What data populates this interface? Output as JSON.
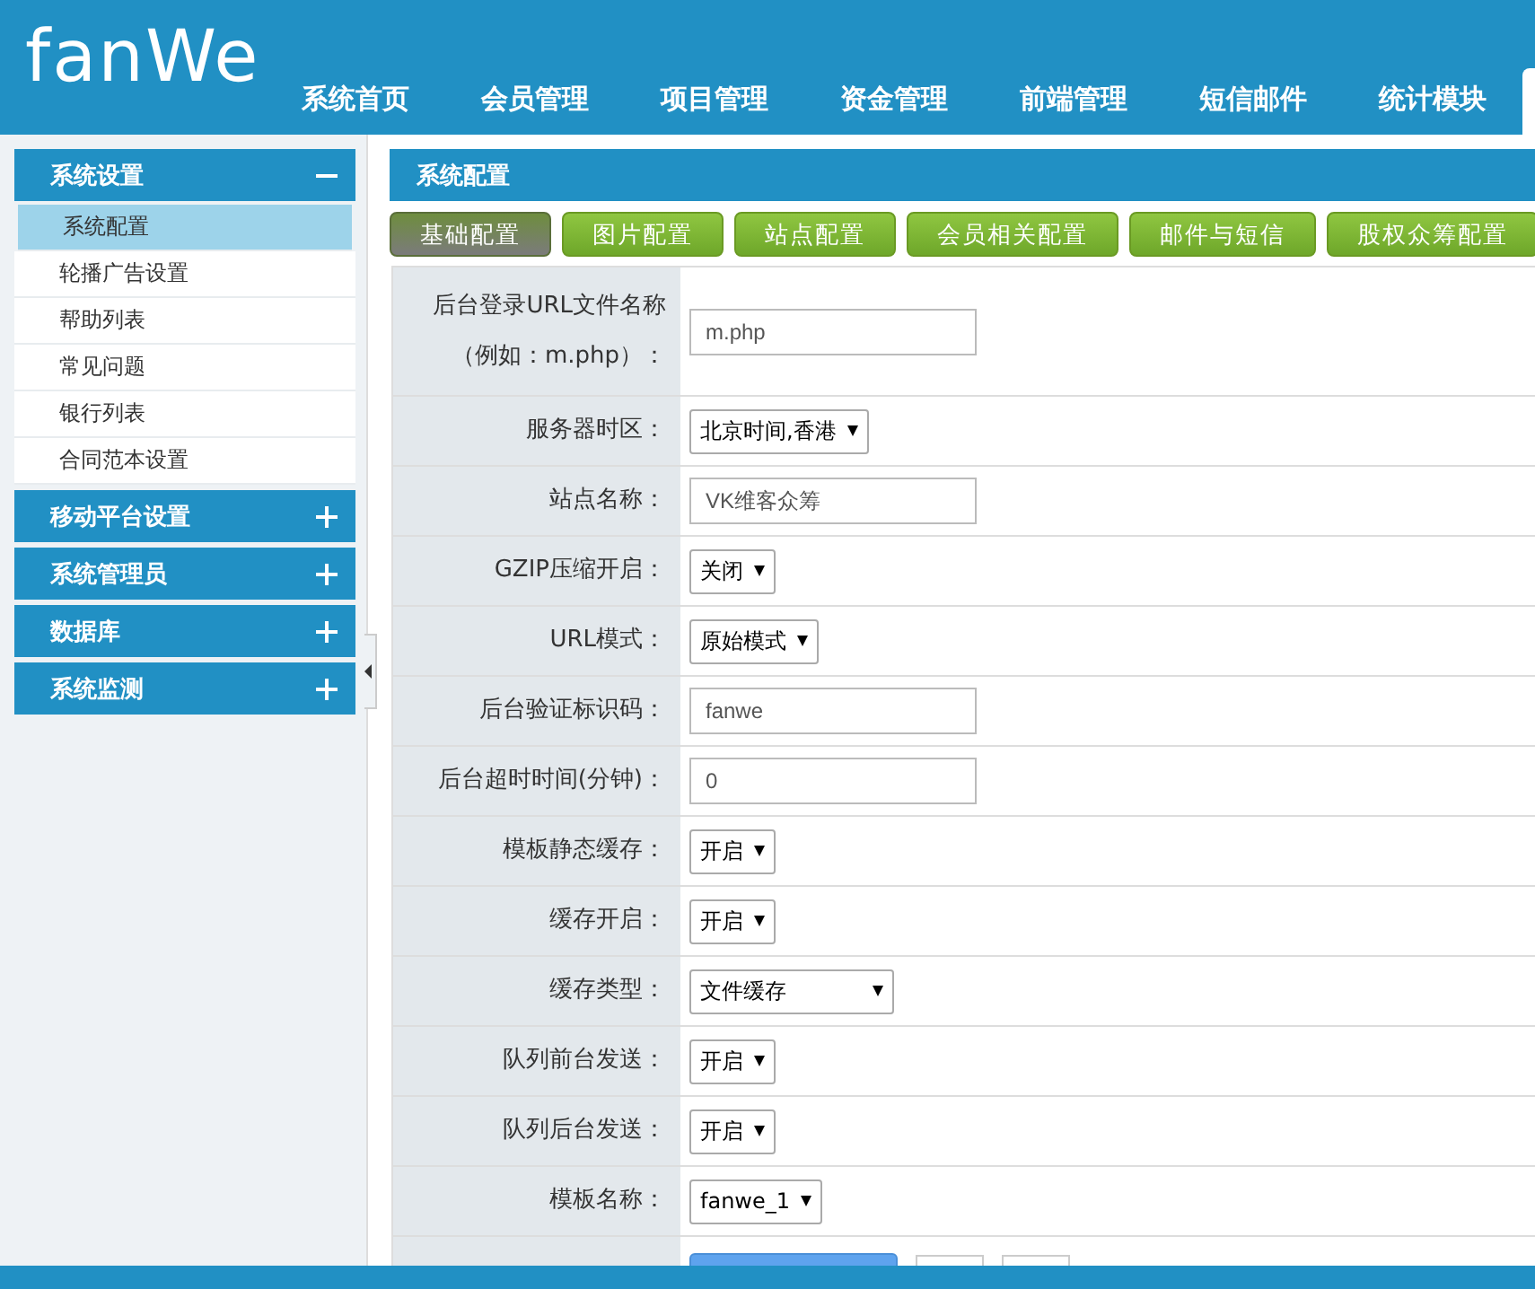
{
  "header": {
    "logo": "fanWe",
    "nav": [
      {
        "label": "系统首页"
      },
      {
        "label": "会员管理"
      },
      {
        "label": "项目管理"
      },
      {
        "label": "资金管理"
      },
      {
        "label": "前端管理"
      },
      {
        "label": "短信邮件"
      },
      {
        "label": "统计模块"
      }
    ]
  },
  "sidebar": {
    "groups": [
      {
        "title": "系统设置",
        "expanded": true,
        "items": [
          {
            "label": "系统配置",
            "selected": true
          },
          {
            "label": "轮播广告设置",
            "selected": false
          },
          {
            "label": "帮助列表",
            "selected": false
          },
          {
            "label": "常见问题",
            "selected": false
          },
          {
            "label": "银行列表",
            "selected": false
          },
          {
            "label": "合同范本设置",
            "selected": false
          }
        ]
      },
      {
        "title": "移动平台设置",
        "expanded": false
      },
      {
        "title": "系统管理员",
        "expanded": false
      },
      {
        "title": "数据库",
        "expanded": false
      },
      {
        "title": "系统监测",
        "expanded": false
      }
    ]
  },
  "panel": {
    "title": "系统配置",
    "tabs": [
      {
        "label": "基础配置",
        "selected": true
      },
      {
        "label": "图片配置",
        "selected": false
      },
      {
        "label": "站点配置",
        "selected": false
      },
      {
        "label": "会员相关配置",
        "selected": false
      },
      {
        "label": "邮件与短信",
        "selected": false
      },
      {
        "label": "股权众筹配置",
        "selected": false
      }
    ],
    "fields": [
      {
        "label": "后台登录URL文件名称",
        "label_2": "（例如：m.php）：",
        "kind": "input",
        "value": "m.php"
      },
      {
        "label": "服务器时区：",
        "kind": "select",
        "value": "北京时间,香港"
      },
      {
        "label": "站点名称：",
        "kind": "input",
        "value": "VK维客众筹"
      },
      {
        "label": "GZIP压缩开启：",
        "kind": "select",
        "value": "关闭"
      },
      {
        "label": "URL模式：",
        "kind": "select",
        "value": "原始模式"
      },
      {
        "label": "后台验证标识码：",
        "kind": "input",
        "value": "fanwe"
      },
      {
        "label": "后台超时时间(分钟)：",
        "kind": "input",
        "value": "0"
      },
      {
        "label": "模板静态缓存：",
        "kind": "select",
        "value": "开启"
      },
      {
        "label": "缓存开启：",
        "kind": "select",
        "value": "开启"
      },
      {
        "label": "缓存类型：",
        "kind": "select",
        "value": "文件缓存",
        "wide": true
      },
      {
        "label": "队列前台发送：",
        "kind": "select",
        "value": "开启"
      },
      {
        "label": "队列后台发送：",
        "kind": "select",
        "value": "开启"
      },
      {
        "label": "模板名称：",
        "kind": "select",
        "value": "fanwe_1"
      },
      {
        "kind": "actions"
      }
    ]
  }
}
